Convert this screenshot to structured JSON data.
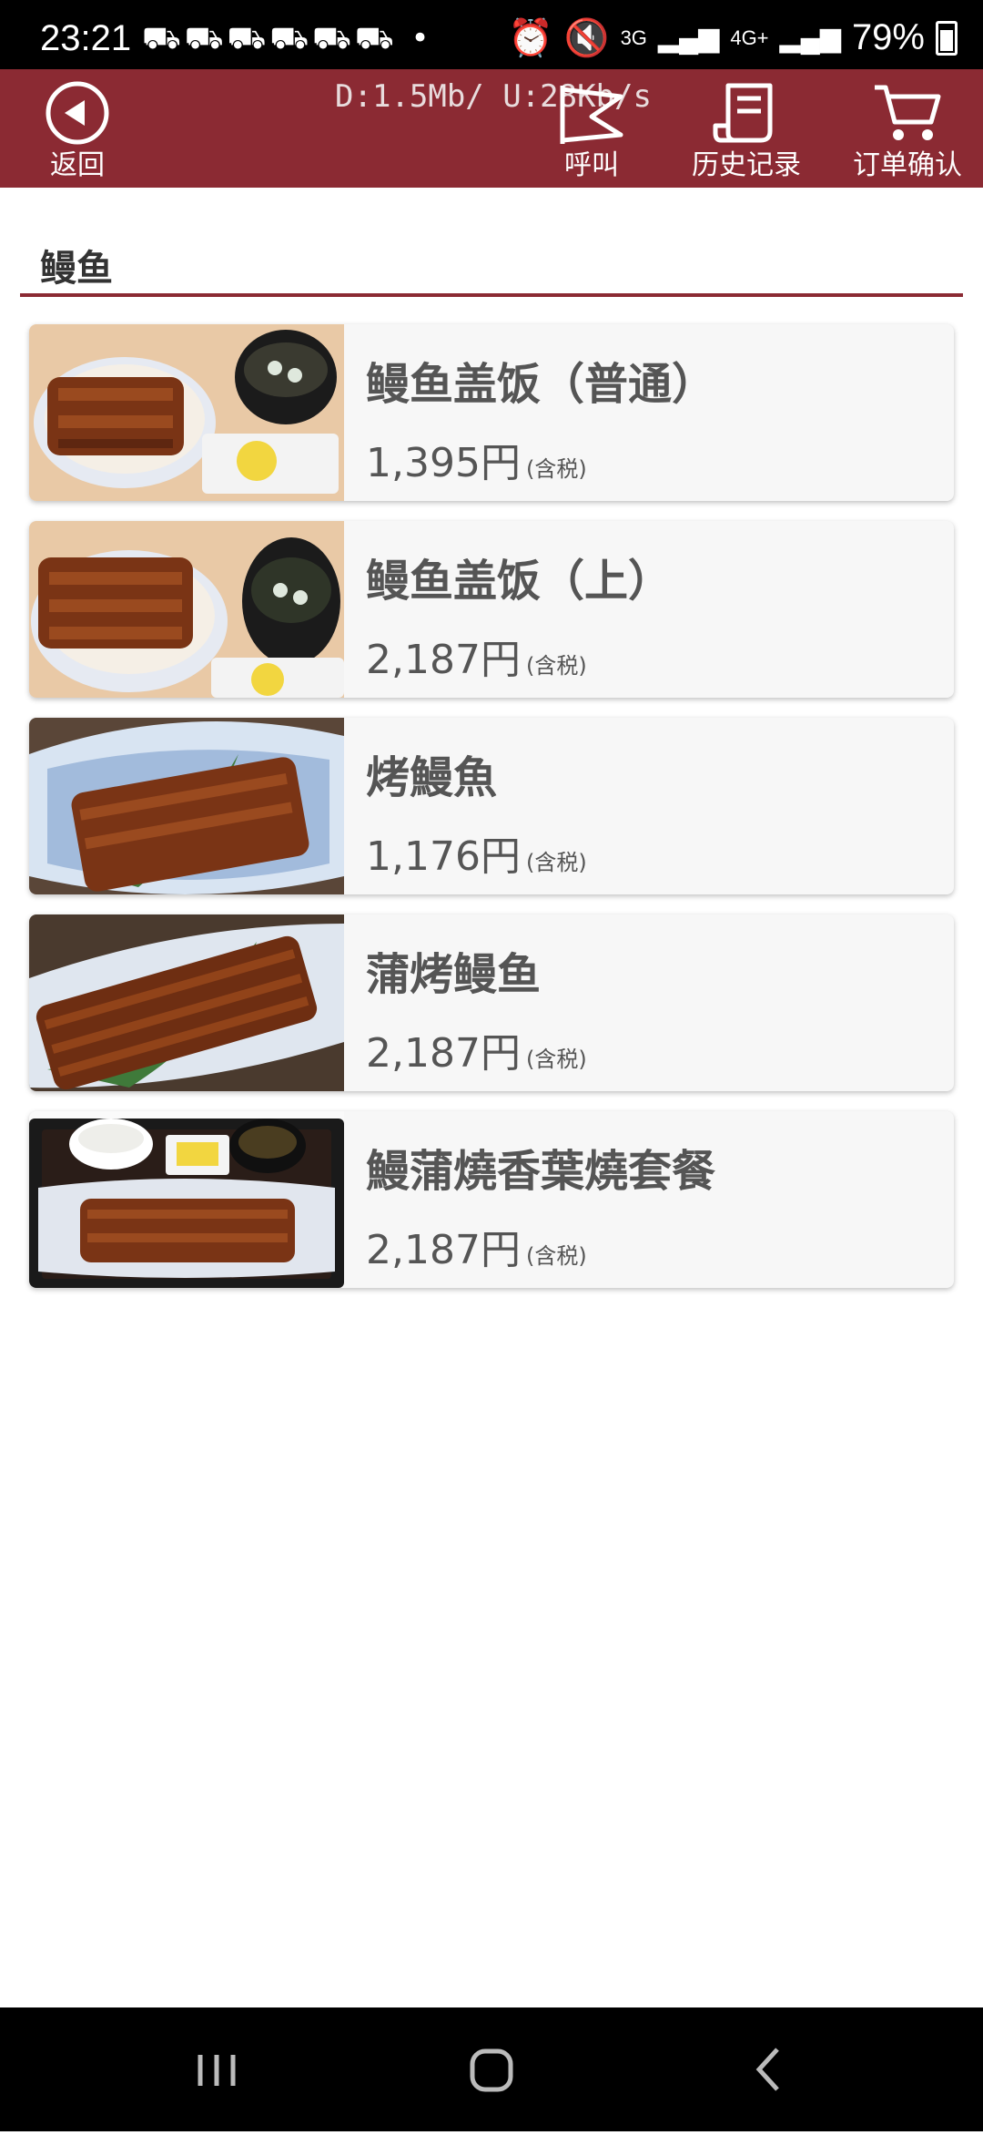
{
  "status_bar": {
    "time": "23:21",
    "notification_icons": "⛟⛟⛟⛟⛟⛟ •",
    "net_3g": "3G",
    "net_4g": "4G+",
    "battery": "79%"
  },
  "header": {
    "net_speed": "D:1.5Mb/ U:28Kb/s",
    "back_label": "返回",
    "call_label": "呼叫",
    "history_label": "历史记录",
    "cart_label": "订单确认",
    "bg_color": "#8b2a33"
  },
  "section": {
    "title": "鳗鱼"
  },
  "menu_items": [
    {
      "name": "鳗鱼盖饭（普通）",
      "price": "1,395円",
      "tax": "(含税)"
    },
    {
      "name": "鳗鱼盖饭（上）",
      "price": "2,187円",
      "tax": "(含税)"
    },
    {
      "name": "烤鰻魚",
      "price": "1,176円",
      "tax": "(含税)"
    },
    {
      "name": "蒲烤鳗鱼",
      "price": "2,187円",
      "tax": "(含税)"
    },
    {
      "name": "鰻蒲燒香葉燒套餐",
      "price": "2,187円",
      "tax": "(含税)"
    }
  ]
}
